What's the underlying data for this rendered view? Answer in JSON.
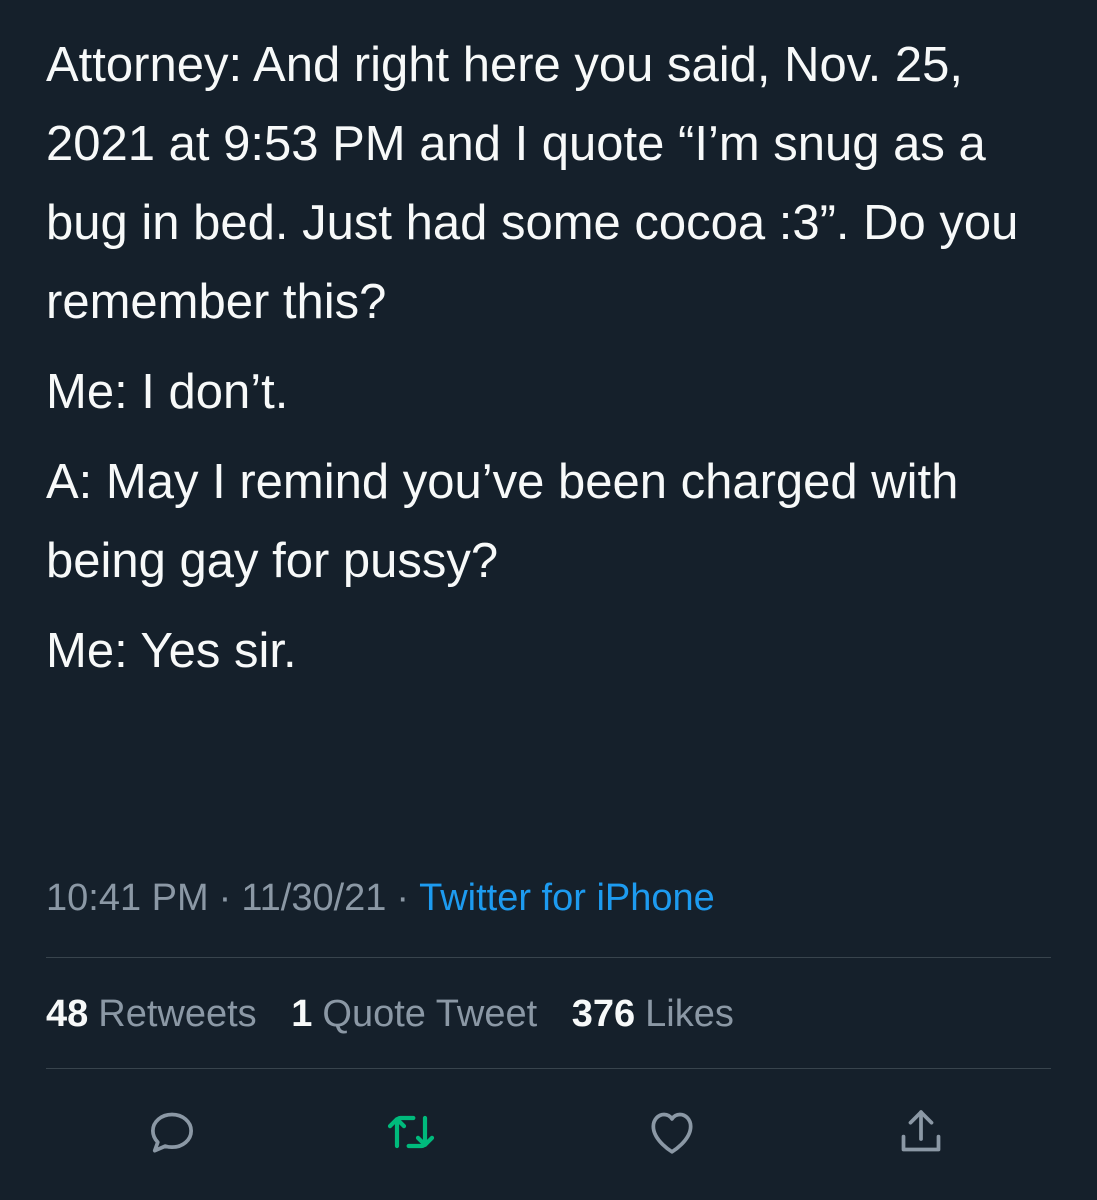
{
  "tweet": {
    "paragraphs": [
      "Attorney: And right here you said, Nov. 25, 2021 at 9:53 PM and I quote “I’m snug as a bug in bed. Just had some cocoa :3”. Do you remember this?",
      "Me: I don’t.",
      "A: May I remind you’ve been charged with being gay for pussy?",
      "Me: Yes sir."
    ],
    "time": "10:41 PM",
    "date": "11/30/21",
    "separator": "·",
    "source": "Twitter for iPhone"
  },
  "stats": {
    "retweets": {
      "count": "48",
      "label": "Retweets"
    },
    "quotes": {
      "count": "1",
      "label": "Quote Tweet"
    },
    "likes": {
      "count": "376",
      "label": "Likes"
    }
  },
  "actions": {
    "reply": {
      "icon": "reply-icon",
      "color": "#8b98a5"
    },
    "retweet": {
      "icon": "retweet-icon",
      "color": "#00ba7c"
    },
    "like": {
      "icon": "heart-icon",
      "color": "#8b98a5"
    },
    "share": {
      "icon": "share-icon",
      "color": "#8b98a5"
    }
  }
}
